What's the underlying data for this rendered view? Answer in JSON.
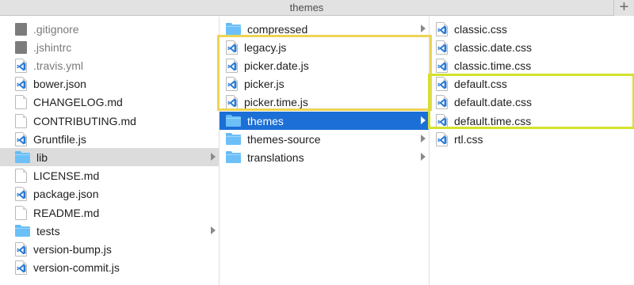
{
  "window": {
    "title": "themes",
    "new_tab_symbol": "+"
  },
  "columns": [
    {
      "items": [
        {
          "name": ".gitignore",
          "icon": "dark-file-icon",
          "dim": true
        },
        {
          "name": ".jshintrc",
          "icon": "dark-file-icon",
          "dim": true
        },
        {
          "name": ".travis.yml",
          "icon": "vscode-file-icon",
          "dim": true
        },
        {
          "name": "bower.json",
          "icon": "vscode-file-icon"
        },
        {
          "name": "CHANGELOG.md",
          "icon": "blank-document-icon"
        },
        {
          "name": "CONTRIBUTING.md",
          "icon": "blank-document-icon"
        },
        {
          "name": "Gruntfile.js",
          "icon": "vscode-file-icon"
        },
        {
          "name": "lib",
          "icon": "folder-icon",
          "folder": true,
          "selected": "gray"
        },
        {
          "name": "LICENSE.md",
          "icon": "blank-document-icon"
        },
        {
          "name": "package.json",
          "icon": "vscode-file-icon"
        },
        {
          "name": "README.md",
          "icon": "blank-document-icon"
        },
        {
          "name": "tests",
          "icon": "folder-icon",
          "folder": true
        },
        {
          "name": "version-bump.js",
          "icon": "vscode-file-icon"
        },
        {
          "name": "version-commit.js",
          "icon": "vscode-file-icon"
        }
      ]
    },
    {
      "items": [
        {
          "name": "compressed",
          "icon": "folder-icon",
          "folder": true
        },
        {
          "name": "legacy.js",
          "icon": "vscode-file-icon"
        },
        {
          "name": "picker.date.js",
          "icon": "vscode-file-icon"
        },
        {
          "name": "picker.js",
          "icon": "vscode-file-icon"
        },
        {
          "name": "picker.time.js",
          "icon": "vscode-file-icon"
        },
        {
          "name": "themes",
          "icon": "folder-icon",
          "folder": true,
          "selected": "blue"
        },
        {
          "name": "themes-source",
          "icon": "folder-icon",
          "folder": true
        },
        {
          "name": "translations",
          "icon": "folder-icon",
          "folder": true
        }
      ]
    },
    {
      "items": [
        {
          "name": "classic.css",
          "icon": "vscode-file-icon"
        },
        {
          "name": "classic.date.css",
          "icon": "vscode-file-icon"
        },
        {
          "name": "classic.time.css",
          "icon": "vscode-file-icon"
        },
        {
          "name": "default.css",
          "icon": "vscode-file-icon"
        },
        {
          "name": "default.date.css",
          "icon": "vscode-file-icon"
        },
        {
          "name": "default.time.css",
          "icon": "vscode-file-icon"
        },
        {
          "name": "rtl.css",
          "icon": "vscode-file-icon"
        }
      ]
    }
  ],
  "colors": {
    "selection_blue": "#1c6fd6",
    "selection_gray": "#dcdcdc",
    "folder_blue": "#6cc0f7",
    "vscode_blue": "#2a7ad3",
    "highlight_yellow": "#ecd455",
    "highlight_lime": "#d3e22d"
  }
}
